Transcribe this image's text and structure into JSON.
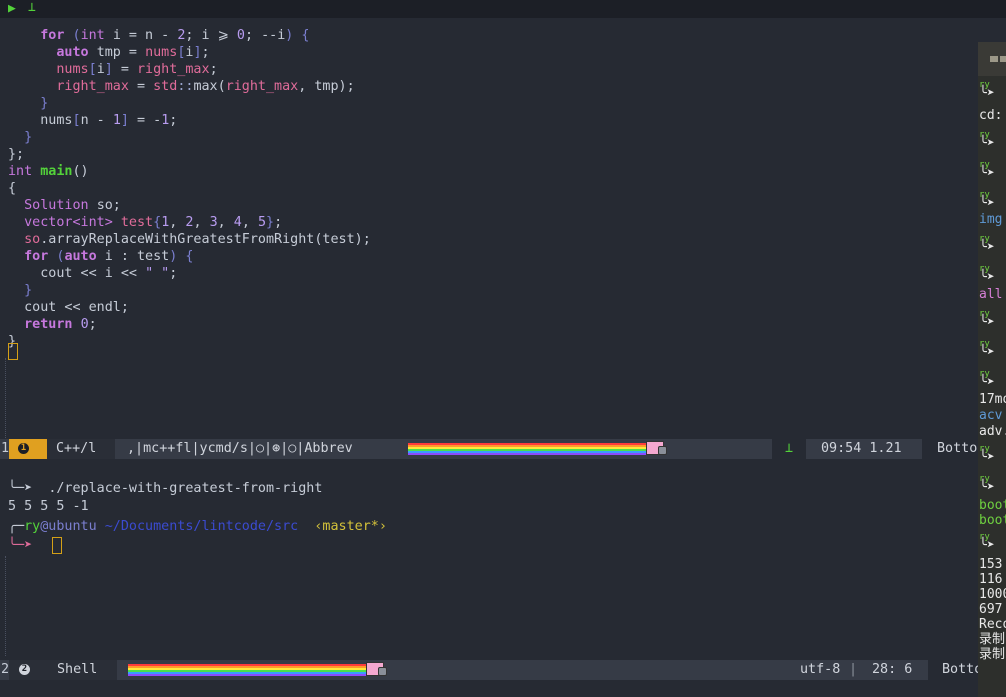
{
  "top": {
    "play_icon": "▶",
    "tee_icon": "⊥"
  },
  "code": {
    "lines": [
      "    for (int i = n - 2; i ⩾ 0; --i) {",
      "      auto tmp = nums[i];",
      "      nums[i] = right_max;",
      "      right_max = std::max(right_max, tmp);",
      "    }",
      "    nums[n - 1] = -1;",
      "  }",
      "};",
      "int main()",
      "{",
      "  Solution so;",
      "  vector<int> test{1, 2, 3, 4, 5};",
      "  so.arrayReplaceWithGreatestFromRight(test);",
      "  for (auto i : test) {",
      "    cout << i << \" \";",
      "  }",
      "  cout << endl;",
      "  return 0;",
      "}"
    ]
  },
  "status1": {
    "window_num": "1",
    "badge": "1",
    "mode": "C++/l",
    "minor_modes": ",|mc++fl|ycmd/s|○|⊛|○|Abbrev",
    "tee": "⊥",
    "time_load": "09:54 1.21",
    "position": "Botto"
  },
  "shell": {
    "command_arrow": "╰─➤",
    "command": "./replace-with-greatest-from-right",
    "output": "5 5 5 5 -1",
    "prompt_corner": "╭─",
    "prompt_user": "ry",
    "prompt_at": "@ubuntu",
    "prompt_path": "~/Documents/lintcode/src",
    "prompt_branch": "‹master*›",
    "prompt_arrow": "╰─➤"
  },
  "status2": {
    "window_num": "2",
    "badge": "2",
    "mode": "Shell",
    "encoding": "utf-8",
    "position": "28: 6",
    "scroll": "Botto"
  },
  "right_strip": {
    "lines": [
      "cd:",
      "img",
      "all",
      "17mo",
      "acv",
      "adv.",
      "boot",
      "boot",
      "153",
      "116",
      "1000",
      "697",
      "Reco",
      "录制",
      "录制"
    ],
    "prompt_fragments": [
      "ry",
      "➤"
    ]
  }
}
